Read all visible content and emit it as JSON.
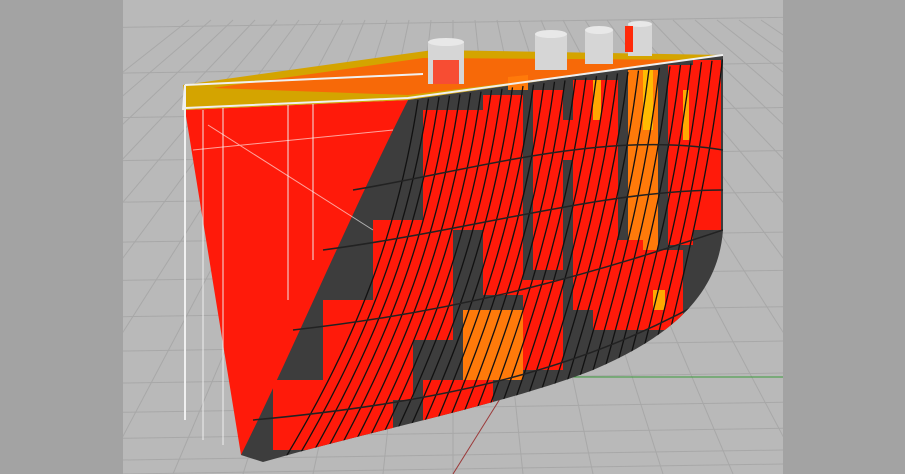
{
  "viewport": {
    "background": "#b9b9b9",
    "grid_color": "#a8a8a8",
    "x_axis_color": "#9b3a3a",
    "y_axis_color": "#3a9b3a",
    "model_name": "ship-hull-bow-block",
    "hull_plate_color": "#3d3d3d",
    "scan_points_color": "#ff1a0a",
    "scan_highlight_color": "#ffcc00",
    "frame_color": "#f0f0f0",
    "pipe_color": "#d6d6d6"
  },
  "side_panel_color": "#a3a3a3"
}
